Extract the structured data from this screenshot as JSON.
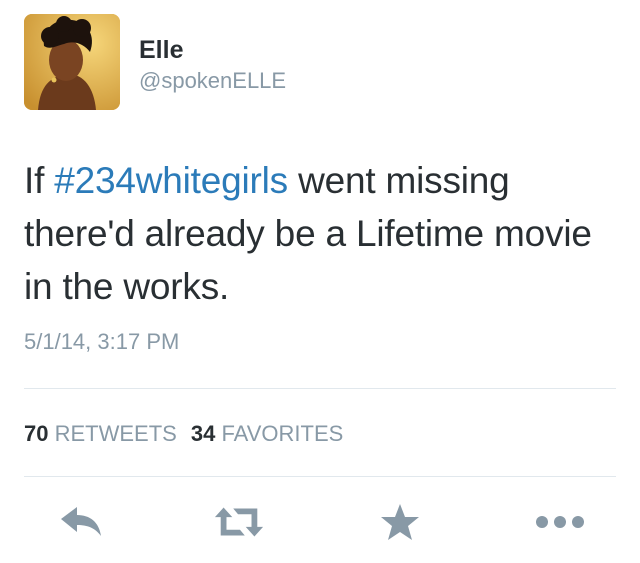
{
  "user": {
    "name": "Elle",
    "handle": "@spokenELLE"
  },
  "tweet": {
    "text_before": "If ",
    "hashtag": "#234whitegirls",
    "text_after": " went missing there'd already be a Lifetime movie in the works.",
    "timestamp": "5/1/14, 3:17 PM"
  },
  "stats": {
    "retweets_count": "70",
    "retweets_label": "RETWEETS",
    "favorites_count": "34",
    "favorites_label": "FAVORITES"
  },
  "actions": {
    "icons": [
      "reply-icon",
      "retweet-icon",
      "favorite-icon",
      "more-icon"
    ]
  },
  "colors": {
    "text": "#292f33",
    "muted": "#8899a6",
    "link": "#2b7bb9",
    "icon": "#8899a6",
    "divider": "#e1e8ed"
  }
}
